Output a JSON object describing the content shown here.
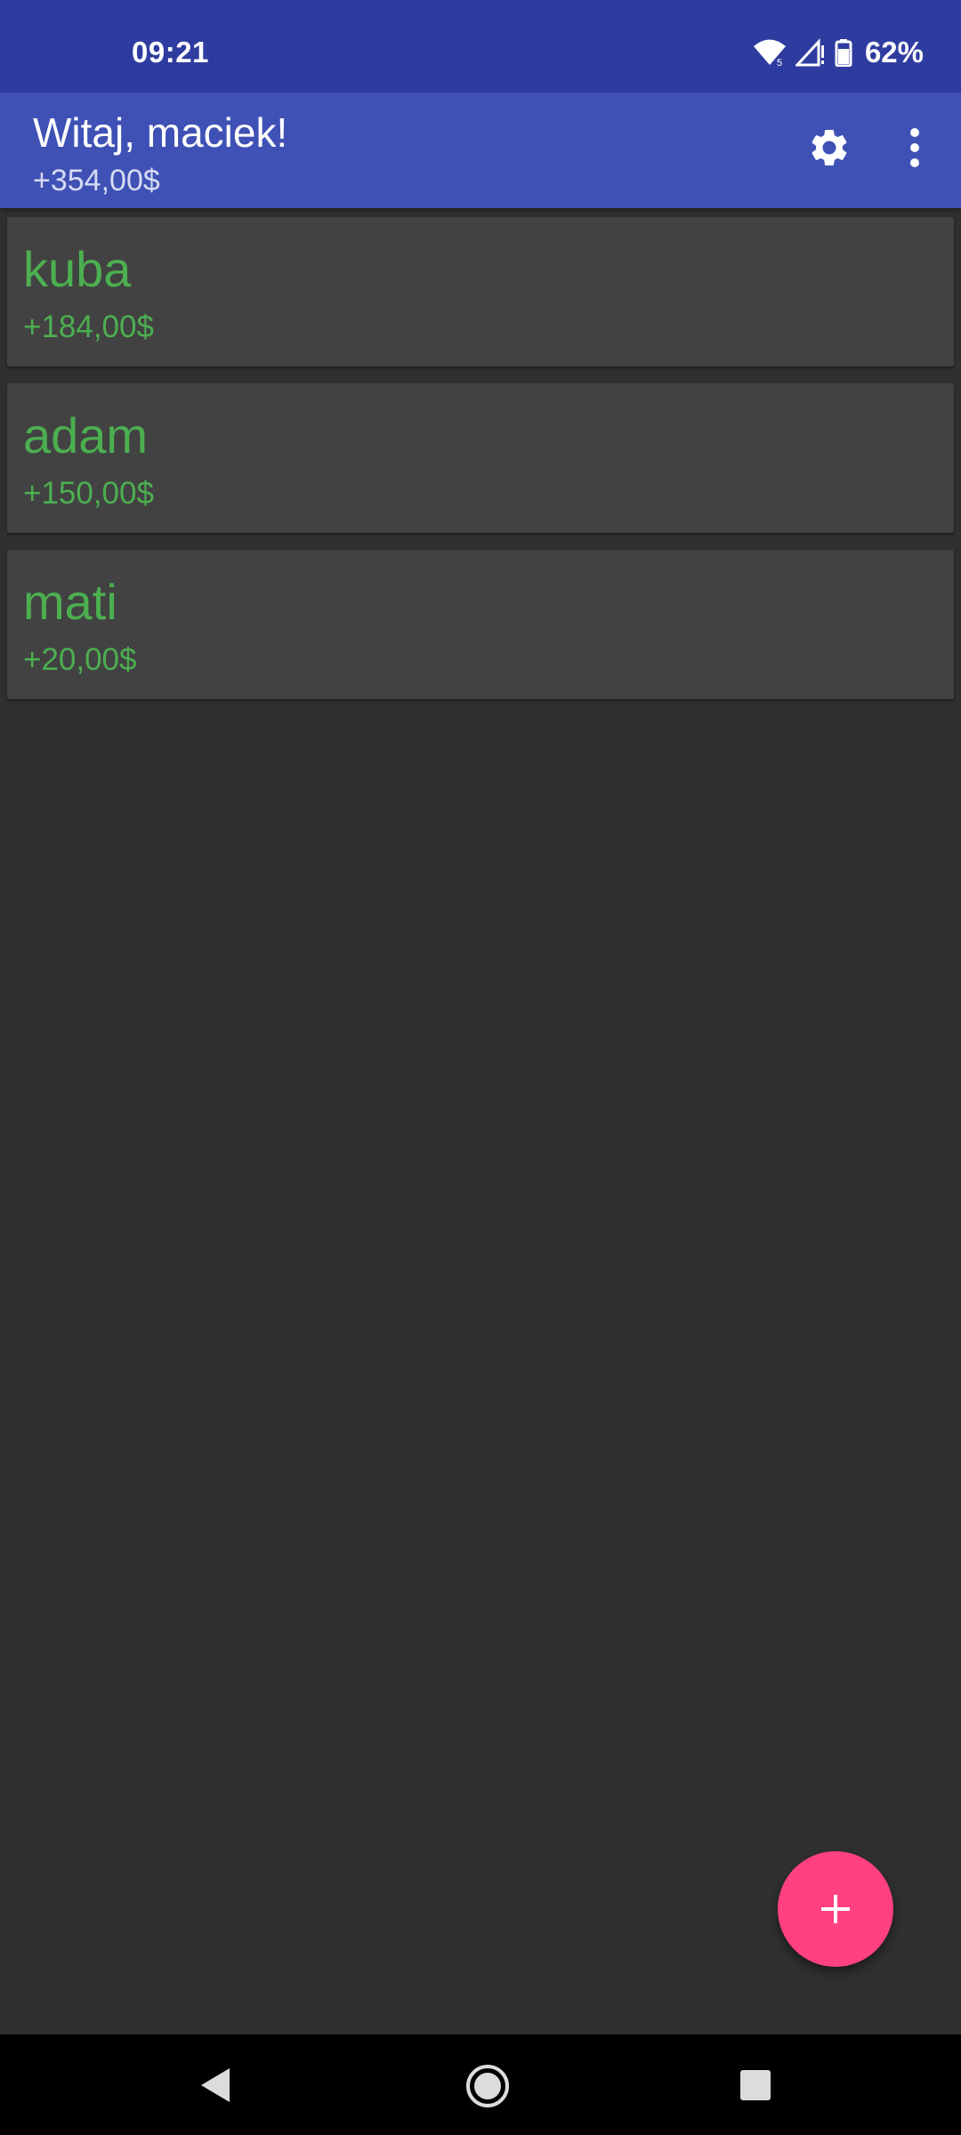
{
  "status_bar": {
    "time": "09:21",
    "battery_percent": "62%",
    "icons": [
      "wifi-icon",
      "signal-icon",
      "battery-icon"
    ]
  },
  "app_bar": {
    "title": "Witaj, maciek!",
    "subtitle": "+354,00$",
    "actions": [
      "gear-icon",
      "more-vert-icon"
    ]
  },
  "friends": [
    {
      "name": "kuba",
      "amount": "+184,00$"
    },
    {
      "name": "adam",
      "amount": "+150,00$"
    },
    {
      "name": "mati",
      "amount": "+20,00$"
    }
  ],
  "fab": {
    "icon": "plus-icon"
  },
  "colors": {
    "status_bar": "#2f3c9f",
    "app_bar": "#3f51b5",
    "background": "#303030",
    "card": "#424242",
    "positive_amount": "#4caf50",
    "fab": "#ff4081",
    "nav_bar": "#000000"
  },
  "nav_bar": {
    "icons": [
      "back-icon",
      "home-icon",
      "recents-icon"
    ]
  }
}
